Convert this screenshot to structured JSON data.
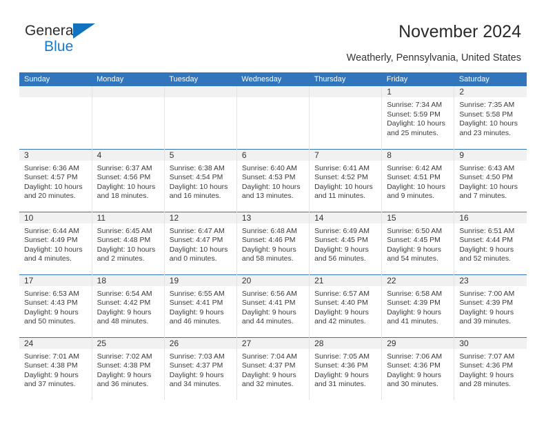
{
  "brand": {
    "logo_line1": "General",
    "logo_line2": "Blue",
    "triangle_color": "#1272bd",
    "blue_text_color": "#1479cd"
  },
  "header": {
    "title": "November 2024",
    "subtitle": "Weatherly, Pennsylvania, United States"
  },
  "theme": {
    "header_blue": "#3176bc",
    "daynum_band": "#f1f1f1",
    "cell_divider": "#e3e3e3",
    "text": "#3a3a3a"
  },
  "calendar": {
    "weekday_headers": [
      "Sunday",
      "Monday",
      "Tuesday",
      "Wednesday",
      "Thursday",
      "Friday",
      "Saturday"
    ],
    "weeks": [
      [
        {
          "day": "",
          "info": ""
        },
        {
          "day": "",
          "info": ""
        },
        {
          "day": "",
          "info": ""
        },
        {
          "day": "",
          "info": ""
        },
        {
          "day": "",
          "info": ""
        },
        {
          "day": "1",
          "info": "Sunrise: 7:34 AM\nSunset: 5:59 PM\nDaylight: 10 hours and 25 minutes."
        },
        {
          "day": "2",
          "info": "Sunrise: 7:35 AM\nSunset: 5:58 PM\nDaylight: 10 hours and 23 minutes."
        }
      ],
      [
        {
          "day": "3",
          "info": "Sunrise: 6:36 AM\nSunset: 4:57 PM\nDaylight: 10 hours and 20 minutes."
        },
        {
          "day": "4",
          "info": "Sunrise: 6:37 AM\nSunset: 4:56 PM\nDaylight: 10 hours and 18 minutes."
        },
        {
          "day": "5",
          "info": "Sunrise: 6:38 AM\nSunset: 4:54 PM\nDaylight: 10 hours and 16 minutes."
        },
        {
          "day": "6",
          "info": "Sunrise: 6:40 AM\nSunset: 4:53 PM\nDaylight: 10 hours and 13 minutes."
        },
        {
          "day": "7",
          "info": "Sunrise: 6:41 AM\nSunset: 4:52 PM\nDaylight: 10 hours and 11 minutes."
        },
        {
          "day": "8",
          "info": "Sunrise: 6:42 AM\nSunset: 4:51 PM\nDaylight: 10 hours and 9 minutes."
        },
        {
          "day": "9",
          "info": "Sunrise: 6:43 AM\nSunset: 4:50 PM\nDaylight: 10 hours and 7 minutes."
        }
      ],
      [
        {
          "day": "10",
          "info": "Sunrise: 6:44 AM\nSunset: 4:49 PM\nDaylight: 10 hours and 4 minutes."
        },
        {
          "day": "11",
          "info": "Sunrise: 6:45 AM\nSunset: 4:48 PM\nDaylight: 10 hours and 2 minutes."
        },
        {
          "day": "12",
          "info": "Sunrise: 6:47 AM\nSunset: 4:47 PM\nDaylight: 10 hours and 0 minutes."
        },
        {
          "day": "13",
          "info": "Sunrise: 6:48 AM\nSunset: 4:46 PM\nDaylight: 9 hours and 58 minutes."
        },
        {
          "day": "14",
          "info": "Sunrise: 6:49 AM\nSunset: 4:45 PM\nDaylight: 9 hours and 56 minutes."
        },
        {
          "day": "15",
          "info": "Sunrise: 6:50 AM\nSunset: 4:45 PM\nDaylight: 9 hours and 54 minutes."
        },
        {
          "day": "16",
          "info": "Sunrise: 6:51 AM\nSunset: 4:44 PM\nDaylight: 9 hours and 52 minutes."
        }
      ],
      [
        {
          "day": "17",
          "info": "Sunrise: 6:53 AM\nSunset: 4:43 PM\nDaylight: 9 hours and 50 minutes."
        },
        {
          "day": "18",
          "info": "Sunrise: 6:54 AM\nSunset: 4:42 PM\nDaylight: 9 hours and 48 minutes."
        },
        {
          "day": "19",
          "info": "Sunrise: 6:55 AM\nSunset: 4:41 PM\nDaylight: 9 hours and 46 minutes."
        },
        {
          "day": "20",
          "info": "Sunrise: 6:56 AM\nSunset: 4:41 PM\nDaylight: 9 hours and 44 minutes."
        },
        {
          "day": "21",
          "info": "Sunrise: 6:57 AM\nSunset: 4:40 PM\nDaylight: 9 hours and 42 minutes."
        },
        {
          "day": "22",
          "info": "Sunrise: 6:58 AM\nSunset: 4:39 PM\nDaylight: 9 hours and 41 minutes."
        },
        {
          "day": "23",
          "info": "Sunrise: 7:00 AM\nSunset: 4:39 PM\nDaylight: 9 hours and 39 minutes."
        }
      ],
      [
        {
          "day": "24",
          "info": "Sunrise: 7:01 AM\nSunset: 4:38 PM\nDaylight: 9 hours and 37 minutes."
        },
        {
          "day": "25",
          "info": "Sunrise: 7:02 AM\nSunset: 4:38 PM\nDaylight: 9 hours and 36 minutes."
        },
        {
          "day": "26",
          "info": "Sunrise: 7:03 AM\nSunset: 4:37 PM\nDaylight: 9 hours and 34 minutes."
        },
        {
          "day": "27",
          "info": "Sunrise: 7:04 AM\nSunset: 4:37 PM\nDaylight: 9 hours and 32 minutes."
        },
        {
          "day": "28",
          "info": "Sunrise: 7:05 AM\nSunset: 4:36 PM\nDaylight: 9 hours and 31 minutes."
        },
        {
          "day": "29",
          "info": "Sunrise: 7:06 AM\nSunset: 4:36 PM\nDaylight: 9 hours and 30 minutes."
        },
        {
          "day": "30",
          "info": "Sunrise: 7:07 AM\nSunset: 4:36 PM\nDaylight: 9 hours and 28 minutes."
        }
      ]
    ]
  }
}
